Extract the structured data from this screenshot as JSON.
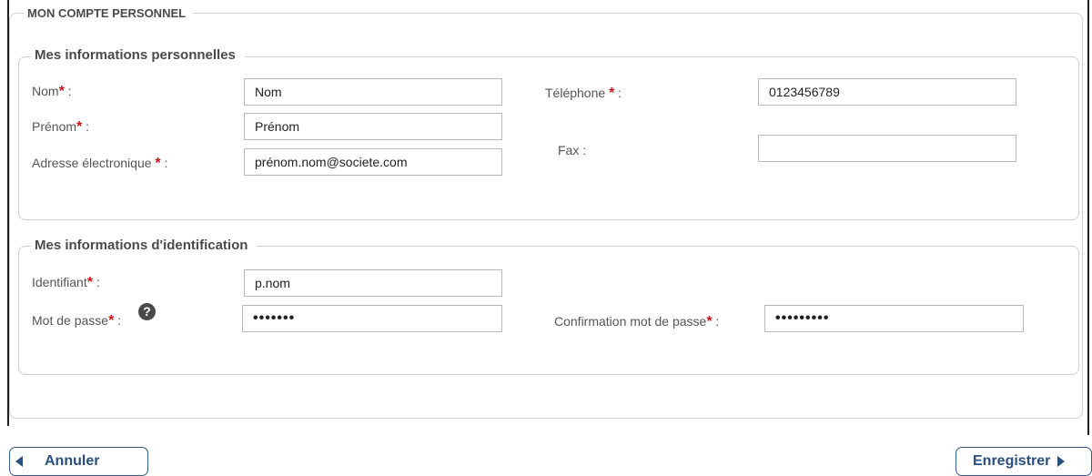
{
  "account": {
    "title": "MON COMPTE PERSONNEL"
  },
  "personal": {
    "legend": "Mes informations personnelles",
    "nom": {
      "label": "Nom",
      "suffix": " :",
      "value": "Nom"
    },
    "prenom": {
      "label": "Prénom",
      "suffix": " :",
      "value": "Prénom"
    },
    "email": {
      "label": "Adresse électronique ",
      "suffix": " :",
      "value": "prénom.nom@societe.com"
    },
    "telephone": {
      "label": "Téléphone ",
      "suffix": " :",
      "value": "0123456789"
    },
    "fax": {
      "label": "Fax :",
      "value": ""
    }
  },
  "identification": {
    "legend": "Mes informations d'identification",
    "identifiant": {
      "label": "Identifiant",
      "suffix": " :",
      "value": "p.nom"
    },
    "password": {
      "label": "Mot de passe",
      "suffix": " :",
      "value": "•••••••"
    },
    "confirm": {
      "label": "Confirmation mot de passe",
      "suffix": " :",
      "value": "•••••••••"
    }
  },
  "required_marker": "*",
  "help_icon": "?",
  "buttons": {
    "cancel": "Annuler",
    "save": "Enregistrer"
  }
}
